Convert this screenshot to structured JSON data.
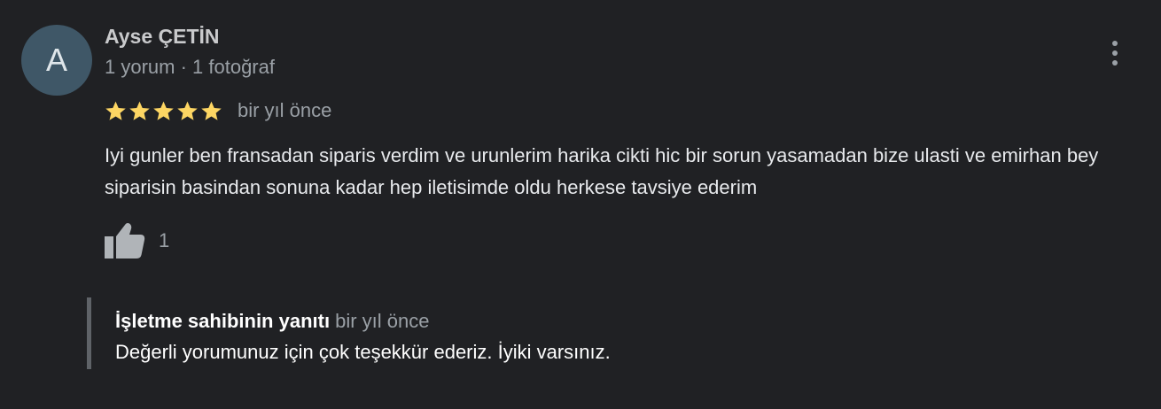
{
  "review": {
    "author": {
      "initial": "A",
      "name": "Ayse ÇETİN",
      "meta": "1 yorum · 1 fotoğraf"
    },
    "rating": 5,
    "rating_max": 5,
    "star_color": "#fdd663",
    "time": "bir yıl önce",
    "text": "Iyi gunler ben fransadan siparis verdim ve urunlerim harika cikti hic bir sorun yasamadan bize ulasti ve emirhan bey siparisin basindan sonuna kadar hep iletisimde oldu herkese tavsiye ederim",
    "likes": "1",
    "more_icon": "more-vert-icon",
    "like_icon": "thumb-up-icon"
  },
  "owner_reply": {
    "title": "İşletme sahibinin yanıtı",
    "time": "bir yıl önce",
    "text": "Değerli yorumunuz için çok teşekkür ederiz. İyiki varsınız."
  },
  "colors": {
    "background": "#202124",
    "avatar_bg": "#3f5767",
    "secondary_text": "#9aa0a6",
    "reply_border": "#5f6368"
  }
}
